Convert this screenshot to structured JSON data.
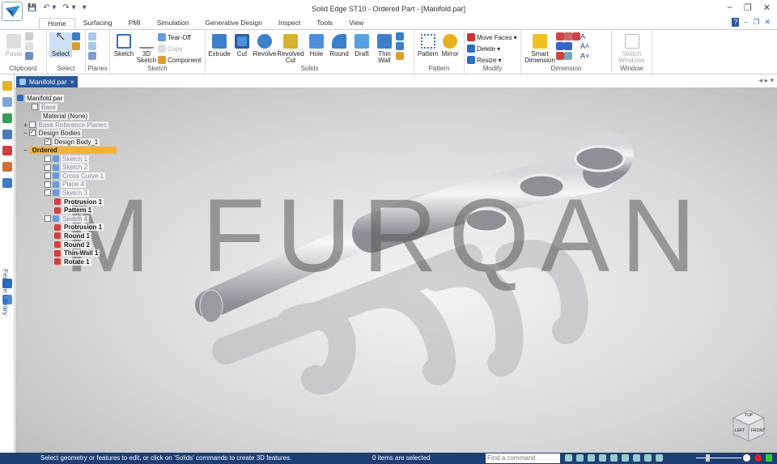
{
  "window": {
    "title": "Solid Edge ST10 - Ordered Part - [Manifold.par]",
    "min": "–",
    "restore": "❐",
    "close": "✕"
  },
  "qat": {
    "save": "💾",
    "undo": "↶ ▾",
    "redo": "↷ ▾",
    "customize": "▾"
  },
  "help": {
    "help": "?",
    "sub_min": "–",
    "sub_restore": "❐",
    "sub_close": "✕"
  },
  "tabs": [
    "Home",
    "Surfacing",
    "PMI",
    "Simulation",
    "Generative Design",
    "Inspect",
    "Tools",
    "View"
  ],
  "ribbon": {
    "clipboard": {
      "label": "Clipboard",
      "paste": "Paste"
    },
    "select": {
      "label": "Select",
      "select": "Select"
    },
    "planes": {
      "label": "Planes"
    },
    "sketch": {
      "label": "Sketch",
      "sketch": "Sketch",
      "sketch3d": "3D Sketch",
      "tearoff": "Tear-Off",
      "copy": "Copy",
      "component": "Component"
    },
    "solids": {
      "label": "Solids",
      "items": [
        "Extrude",
        "Cut",
        "Revolve",
        "Revolved Cut",
        "Hole",
        "Round",
        "Draft",
        "Thin Wall"
      ]
    },
    "pattern": {
      "label": "Pattern",
      "pattern": "Pattern",
      "mirror": "Mirror"
    },
    "modify": {
      "label": "Modify",
      "move_faces": "Move Faces",
      "delete": "Delete",
      "resize": "Resize"
    },
    "dimension": {
      "label": "Dimension",
      "smart": "Smart Dimension"
    },
    "window": {
      "label": "Window",
      "switch": "Switch Windows"
    }
  },
  "doc_tab": {
    "name": "Manifold.par",
    "close": "×"
  },
  "side_label": "Feature Library",
  "tree": {
    "root": "Manifold.par",
    "base": "Base",
    "material": "Material (None)",
    "ref_planes": "Base Reference Planes",
    "design_bodies": "Design Bodies",
    "design_body": "Design Body_1",
    "ordered": "Ordered",
    "features": [
      {
        "label": "Sketch 1",
        "check": true,
        "dim": true
      },
      {
        "label": "Sketch 2",
        "check": true,
        "dim": true
      },
      {
        "label": "Cross Curve 1",
        "check": true,
        "dim": true
      },
      {
        "label": "Plane 4",
        "check": true,
        "dim": true
      },
      {
        "label": "Sketch 3",
        "check": true,
        "dim": true
      },
      {
        "label": "Protrusion 1",
        "check": false,
        "dim": false
      },
      {
        "label": "Pattern 1",
        "check": false,
        "dim": false
      },
      {
        "label": "Sketch 4",
        "check": true,
        "dim": true
      },
      {
        "label": "Protrusion 1",
        "check": false,
        "dim": false
      },
      {
        "label": "Round 1",
        "check": false,
        "dim": false
      },
      {
        "label": "Round 2",
        "check": false,
        "dim": false
      },
      {
        "label": "Thin-Wall 1",
        "check": false,
        "dim": false
      },
      {
        "label": "Rotate 1",
        "check": false,
        "dim": false
      }
    ]
  },
  "watermark": "M FURQAN",
  "viewcube": {
    "top": "TOP",
    "left": "LEFT",
    "front": "FRONT"
  },
  "status": {
    "message": "Select geometry or features to edit, or click on 'Solids' commands to create 3D features.",
    "count": "0 items are selected",
    "find_placeholder": "Find a command"
  }
}
